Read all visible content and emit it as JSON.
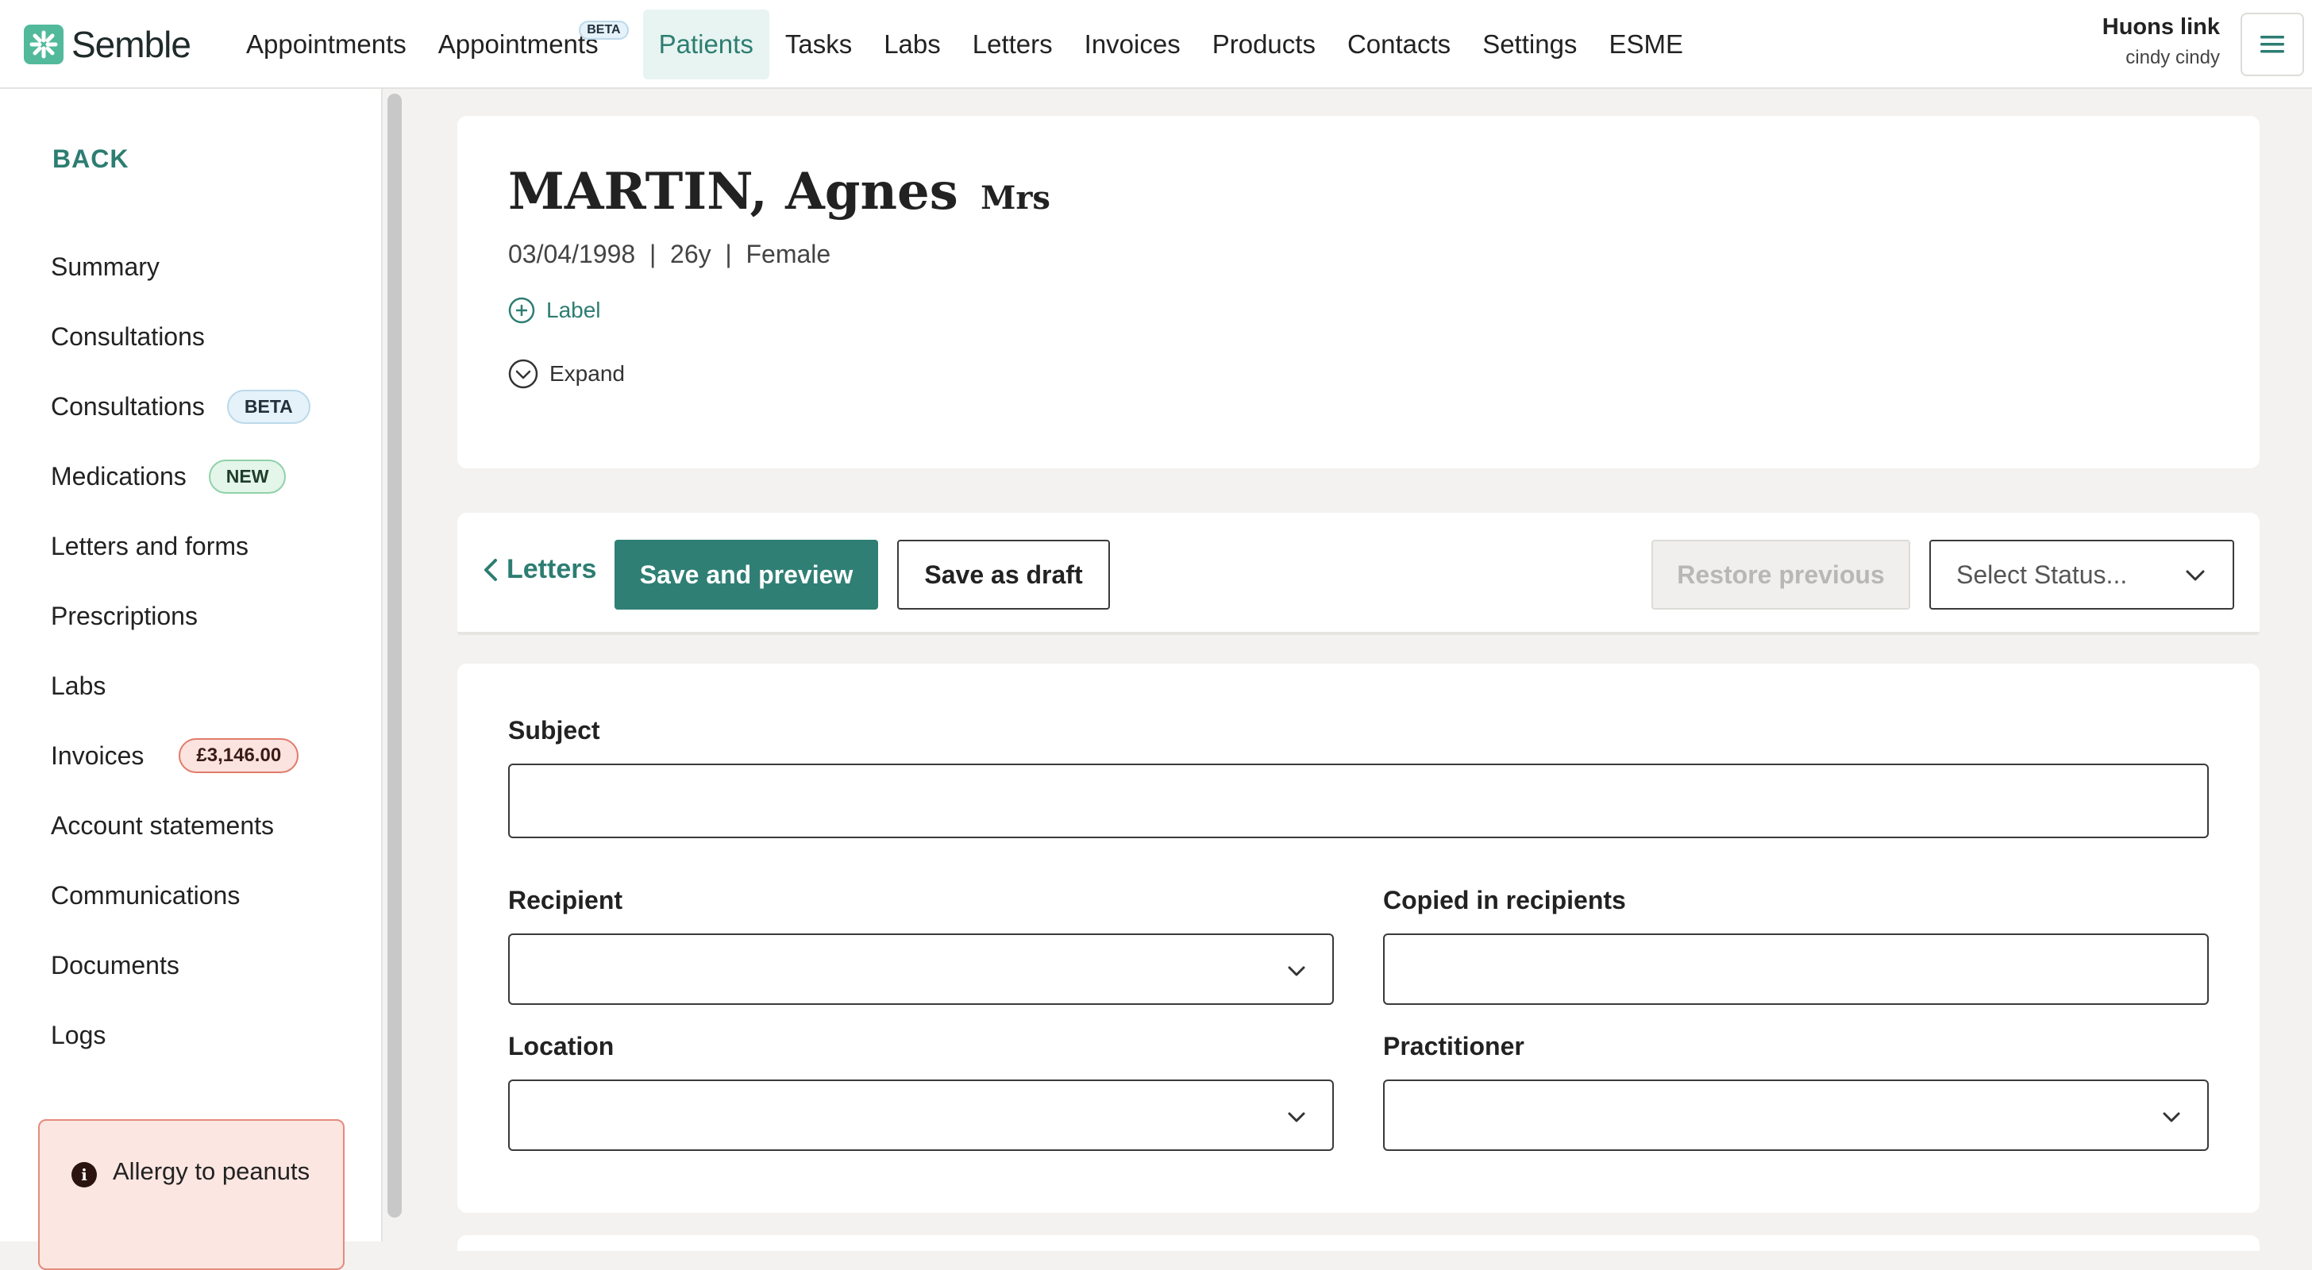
{
  "app": {
    "brand": "Semble",
    "brand_color": "#52b99b",
    "accent_color": "#2f7f75"
  },
  "nav": {
    "items": [
      {
        "label": "Appointments"
      },
      {
        "label": "Appointments",
        "badge": "BETA"
      },
      {
        "label": "Patients",
        "active": true
      },
      {
        "label": "Tasks"
      },
      {
        "label": "Labs"
      },
      {
        "label": "Letters"
      },
      {
        "label": "Invoices"
      },
      {
        "label": "Products"
      },
      {
        "label": "Contacts"
      },
      {
        "label": "Settings"
      },
      {
        "label": "ESME"
      }
    ],
    "menu_icon": "hamburger-menu-icon"
  },
  "user": {
    "org": "Huons link",
    "name": "cindy cindy"
  },
  "sidebar": {
    "back_label": "BACK",
    "items": [
      {
        "label": "Summary"
      },
      {
        "label": "Consultations"
      },
      {
        "label": "Consultations",
        "badge": "BETA"
      },
      {
        "label": "Medications",
        "badge": "NEW"
      },
      {
        "label": "Letters and forms"
      },
      {
        "label": "Prescriptions"
      },
      {
        "label": "Labs"
      },
      {
        "label": "Invoices",
        "badge": "£3,146.00"
      },
      {
        "label": "Account statements"
      },
      {
        "label": "Communications"
      },
      {
        "label": "Documents"
      },
      {
        "label": "Logs"
      }
    ],
    "allergy_icon": "info-icon",
    "allergy_text": "Allergy to peanuts"
  },
  "patient": {
    "name": "MARTIN, Agnes",
    "title": "Mrs",
    "dob": "03/04/1998",
    "age": "26y",
    "sex": "Female",
    "label_link": "Label",
    "expand_link": "Expand"
  },
  "toolbar": {
    "back_link": "Letters",
    "save_preview": "Save and preview",
    "save_draft": "Save as draft",
    "restore": "Restore previous",
    "status_placeholder": "Select Status..."
  },
  "form": {
    "subject_label": "Subject",
    "subject_value": "",
    "recipient_label": "Recipient",
    "recipient_value": "",
    "copied_label": "Copied in recipients",
    "copied_value": "",
    "location_label": "Location",
    "location_value": "",
    "practitioner_label": "Practitioner",
    "practitioner_value": ""
  }
}
